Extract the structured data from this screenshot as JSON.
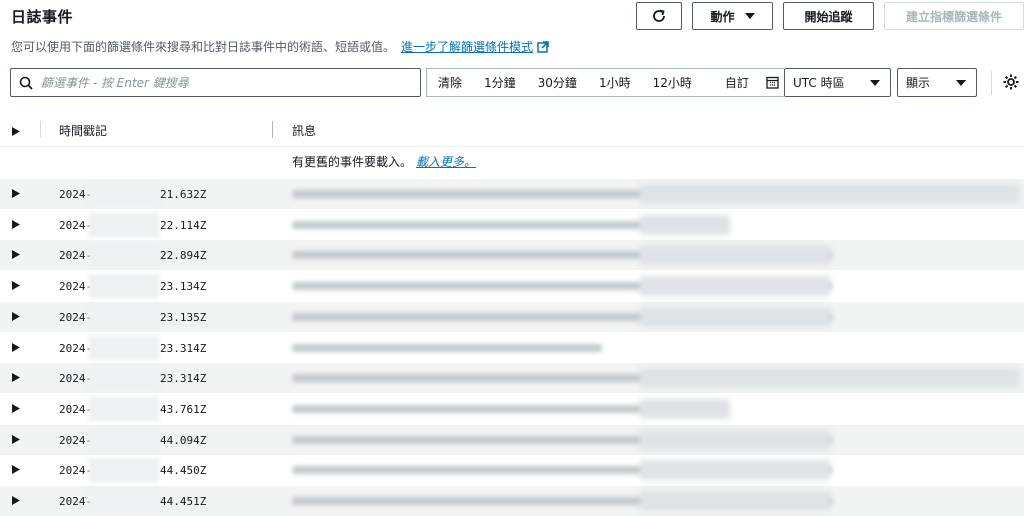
{
  "header": {
    "title": "日誌事件",
    "description": "您可以使用下面的篩選條件來搜尋和比對日誌事件中的術語、短語或值。",
    "learn_more": "進一步了解篩選條件模式",
    "refresh_icon": "refresh-icon",
    "actions_label": "動作",
    "start_tailing_label": "開始追蹤",
    "create_metric_filter_label": "建立指標篩選條件"
  },
  "filters": {
    "search_placeholder": "篩選事件 - 按 Enter 鍵搜尋",
    "search_value": "",
    "time_ranges": [
      "清除",
      "1分鐘",
      "30分鐘",
      "1小時",
      "12小時",
      "自訂"
    ],
    "timezone": "UTC 時區",
    "display_label": "顯示"
  },
  "table": {
    "col_timestamp": "時間戳記",
    "col_message": "訊息",
    "load_more_text": "有更舊的事件要載入。",
    "load_more_link": "載入更多。",
    "rows": [
      {
        "ts_prefix": "2024-",
        "ts_suffix": "21.632Z"
      },
      {
        "ts_prefix": "2024-",
        "ts_suffix": "22.114Z"
      },
      {
        "ts_prefix": "2024-",
        "ts_suffix": "22.894Z"
      },
      {
        "ts_prefix": "2024-",
        "ts_suffix": "23.134Z"
      },
      {
        "ts_prefix": "2024-",
        "ts_suffix": "23.135Z"
      },
      {
        "ts_prefix": "2024-",
        "ts_suffix": "23.314Z"
      },
      {
        "ts_prefix": "2024-",
        "ts_suffix": "23.314Z"
      },
      {
        "ts_prefix": "2024-",
        "ts_suffix": "43.761Z"
      },
      {
        "ts_prefix": "2024-",
        "ts_suffix": "44.094Z"
      },
      {
        "ts_prefix": "2024-",
        "ts_suffix": "44.450Z"
      },
      {
        "ts_prefix": "2024-",
        "ts_suffix": "44.451Z"
      }
    ]
  },
  "colors": {
    "link": "#0073bb",
    "row_alt": "#f2f3f3",
    "border": "#545b64"
  }
}
